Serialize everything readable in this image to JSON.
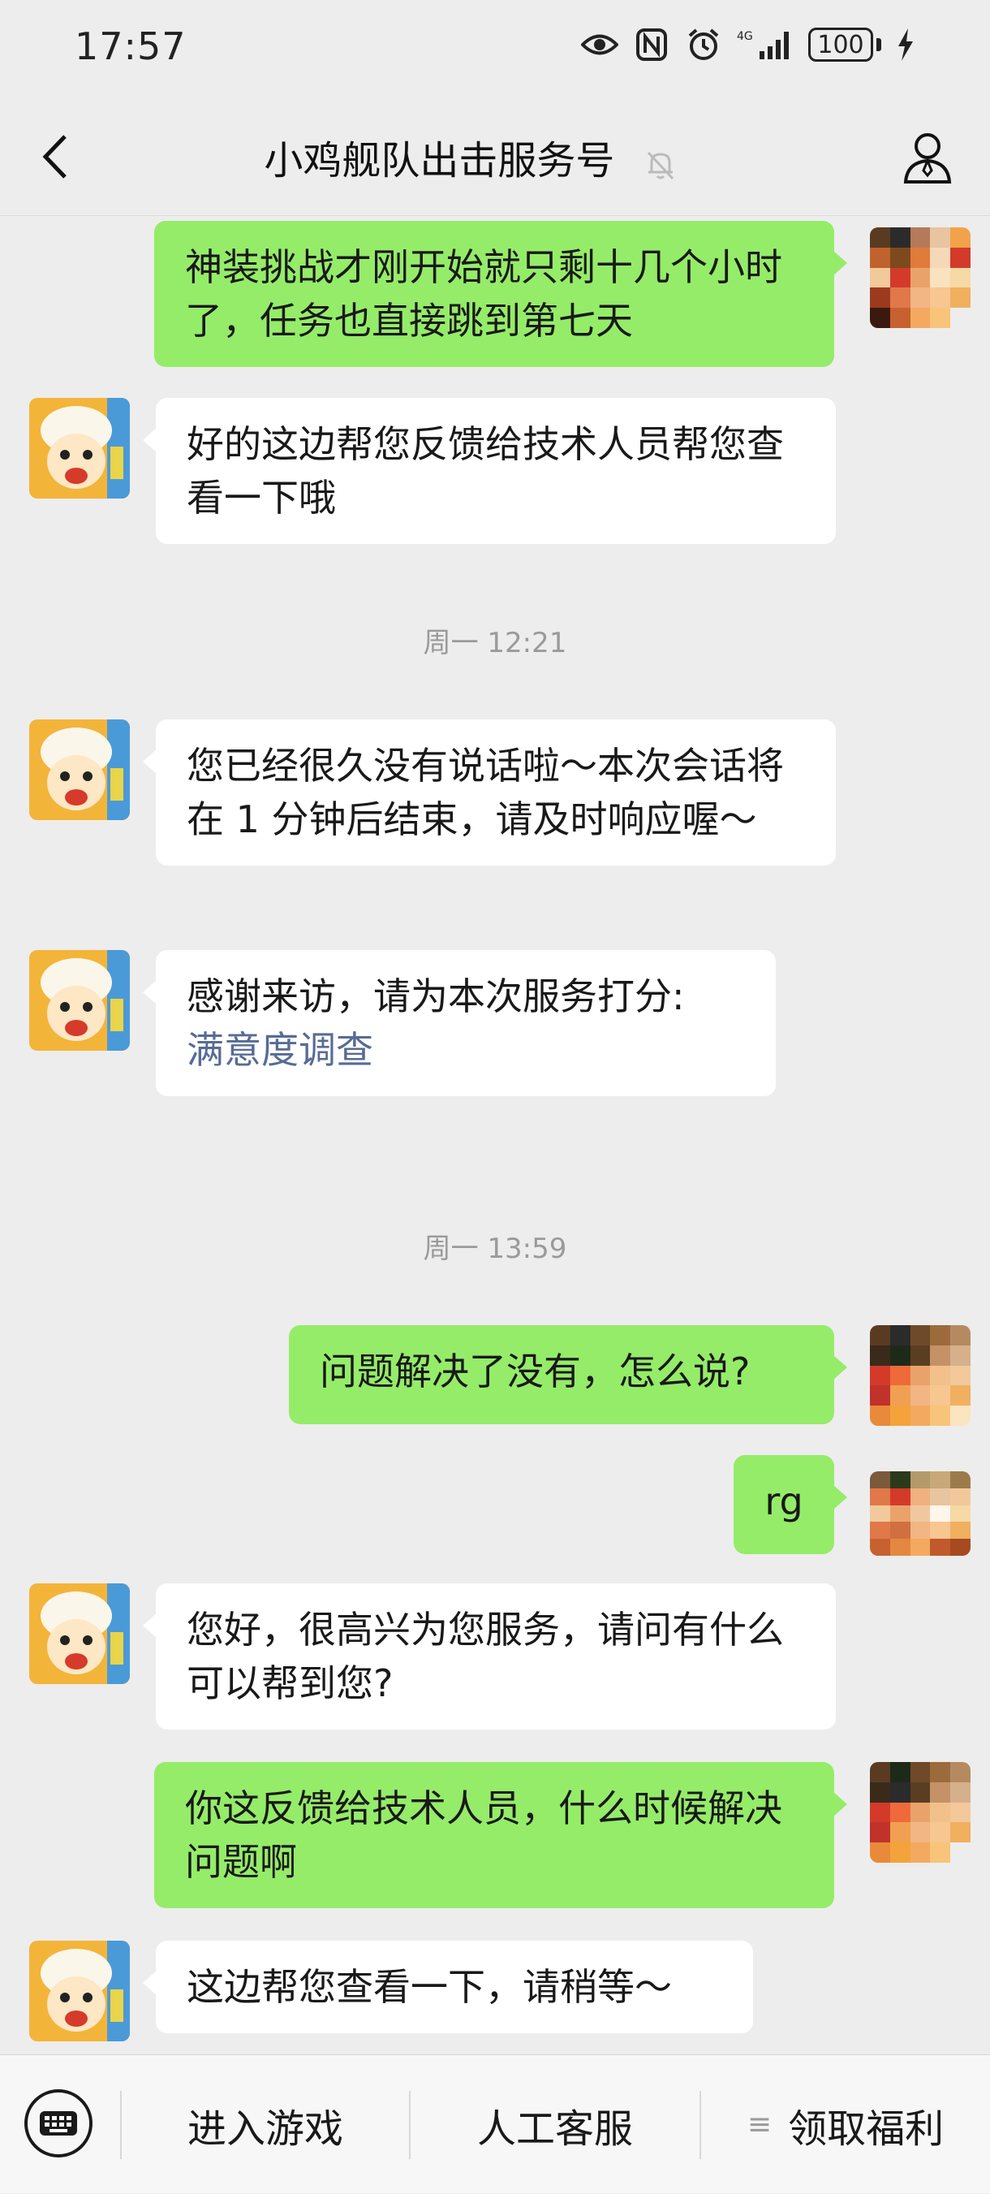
{
  "status_bar": {
    "time": "17:57",
    "signal_label": "4G",
    "battery": "100",
    "icons": [
      "eye-icon",
      "nfc-icon",
      "alarm-icon",
      "signal-icon",
      "battery-icon",
      "charging-icon"
    ]
  },
  "header": {
    "title": "小鸡舰队出击服务号",
    "icons": [
      "back-icon",
      "mute-bell-icon",
      "profile-icon"
    ]
  },
  "messages": [
    {
      "side": "out",
      "text": "神装挑战才刚开始就只剩十几个小时了，任务也直接跳到第七天"
    },
    {
      "side": "in",
      "text": "好的这边帮您反馈给技术人员帮您查看一下哦"
    },
    {
      "type": "time",
      "text": "周一 12:21"
    },
    {
      "side": "in",
      "text": "您已经很久没有说话啦～本次会话将在 1 分钟后结束，请及时响应喔～"
    },
    {
      "side": "in",
      "text": "感谢来访，请为本次服务打分:",
      "link": "满意度调查"
    },
    {
      "type": "time",
      "text": "周一 13:59"
    },
    {
      "side": "out",
      "text": "问题解决了没有，怎么说?"
    },
    {
      "side": "out",
      "text": "rg"
    },
    {
      "side": "in",
      "text": "您好，很高兴为您服务，请问有什么可以帮到您?"
    },
    {
      "side": "out",
      "text": "你这反馈给技术人员，什么时候解决问题啊"
    },
    {
      "side": "in",
      "text": "这边帮您查看一下，请稍等～"
    }
  ],
  "bottom_menu": {
    "items": [
      "进入游戏",
      "人工客服",
      "领取福利"
    ],
    "icons": [
      "keyboard-icon",
      "menu-lines-icon"
    ]
  },
  "colors": {
    "background": "#ededed",
    "outgoing_bubble": "#95ec69",
    "incoming_bubble": "#ffffff",
    "link": "#576b95"
  }
}
